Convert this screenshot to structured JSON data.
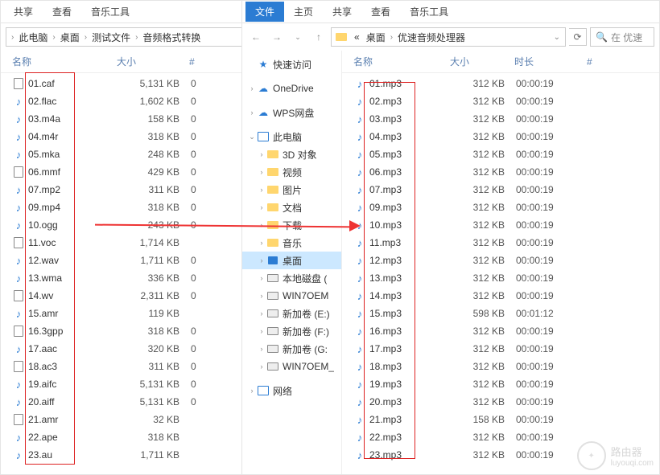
{
  "left_window": {
    "tabs": [
      "共享",
      "查看",
      "音乐工具"
    ],
    "breadcrumbs": [
      "此电脑",
      "桌面",
      "测试文件",
      "音频格式转换"
    ],
    "columns": {
      "name": "名称",
      "size": "大小",
      "hash": "#"
    },
    "files": [
      {
        "name": "01.caf",
        "size": "5,131 KB",
        "hash": "0",
        "icon": "doc"
      },
      {
        "name": "02.flac",
        "size": "1,602 KB",
        "hash": "0",
        "icon": "music"
      },
      {
        "name": "03.m4a",
        "size": "158 KB",
        "hash": "0",
        "icon": "music"
      },
      {
        "name": "04.m4r",
        "size": "318 KB",
        "hash": "0",
        "icon": "music"
      },
      {
        "name": "05.mka",
        "size": "248 KB",
        "hash": "0",
        "icon": "music"
      },
      {
        "name": "06.mmf",
        "size": "429 KB",
        "hash": "0",
        "icon": "doc"
      },
      {
        "name": "07.mp2",
        "size": "311 KB",
        "hash": "0",
        "icon": "music"
      },
      {
        "name": "09.mp4",
        "size": "318 KB",
        "hash": "0",
        "icon": "music"
      },
      {
        "name": "10.ogg",
        "size": "243 KB",
        "hash": "0",
        "icon": "music"
      },
      {
        "name": "11.voc",
        "size": "1,714 KB",
        "hash": "",
        "icon": "doc"
      },
      {
        "name": "12.wav",
        "size": "1,711 KB",
        "hash": "0",
        "icon": "music"
      },
      {
        "name": "13.wma",
        "size": "336 KB",
        "hash": "0",
        "icon": "music"
      },
      {
        "name": "14.wv",
        "size": "2,311 KB",
        "hash": "0",
        "icon": "doc"
      },
      {
        "name": "15.amr",
        "size": "119 KB",
        "hash": "",
        "icon": "music"
      },
      {
        "name": "16.3gpp",
        "size": "318 KB",
        "hash": "0",
        "icon": "doc"
      },
      {
        "name": "17.aac",
        "size": "320 KB",
        "hash": "0",
        "icon": "music"
      },
      {
        "name": "18.ac3",
        "size": "311 KB",
        "hash": "0",
        "icon": "doc"
      },
      {
        "name": "19.aifc",
        "size": "5,131 KB",
        "hash": "0",
        "icon": "music"
      },
      {
        "name": "20.aiff",
        "size": "5,131 KB",
        "hash": "0",
        "icon": "music"
      },
      {
        "name": "21.amr",
        "size": "32 KB",
        "hash": "",
        "icon": "doc"
      },
      {
        "name": "22.ape",
        "size": "318 KB",
        "hash": "",
        "icon": "music"
      },
      {
        "name": "23.au",
        "size": "1,711 KB",
        "hash": "",
        "icon": "music"
      }
    ]
  },
  "right_window": {
    "tabs": [
      "文件",
      "主页",
      "共享",
      "查看",
      "音乐工具"
    ],
    "breadcrumbs_prefix": "«",
    "breadcrumbs": [
      "桌面",
      "优速音频处理器"
    ],
    "search_placeholder": "在 优速",
    "columns": {
      "name": "名称",
      "size": "大小",
      "duration": "时长",
      "hash": "#"
    },
    "sidebar": [
      {
        "label": "快速访问",
        "icon": "star",
        "expand": "none",
        "indent": 0
      },
      {
        "label": "OneDrive",
        "icon": "cloud",
        "expand": "collapsed",
        "indent": 0
      },
      {
        "label": "WPS网盘",
        "icon": "cloud",
        "expand": "collapsed",
        "indent": 0
      },
      {
        "label": "此电脑",
        "icon": "pc",
        "expand": "expanded",
        "indent": 0
      },
      {
        "label": "3D 对象",
        "icon": "folder",
        "expand": "collapsed",
        "indent": 1
      },
      {
        "label": "视频",
        "icon": "folder",
        "expand": "collapsed",
        "indent": 1
      },
      {
        "label": "图片",
        "icon": "folder",
        "expand": "collapsed",
        "indent": 1
      },
      {
        "label": "文档",
        "icon": "folder",
        "expand": "collapsed",
        "indent": 1
      },
      {
        "label": "下载",
        "icon": "folder",
        "expand": "collapsed",
        "indent": 1
      },
      {
        "label": "音乐",
        "icon": "folder",
        "expand": "collapsed",
        "indent": 1
      },
      {
        "label": "桌面",
        "icon": "desktop",
        "expand": "collapsed",
        "indent": 1,
        "selected": true
      },
      {
        "label": "本地磁盘 (",
        "icon": "drive",
        "expand": "collapsed",
        "indent": 1
      },
      {
        "label": "WIN7OEM",
        "icon": "drive",
        "expand": "collapsed",
        "indent": 1
      },
      {
        "label": "新加卷 (E:)",
        "icon": "drive",
        "expand": "collapsed",
        "indent": 1
      },
      {
        "label": "新加卷 (F:)",
        "icon": "drive",
        "expand": "collapsed",
        "indent": 1
      },
      {
        "label": "新加卷 (G:",
        "icon": "drive",
        "expand": "collapsed",
        "indent": 1
      },
      {
        "label": "WIN7OEM_",
        "icon": "drive",
        "expand": "collapsed",
        "indent": 1
      },
      {
        "label": "网络",
        "icon": "pc",
        "expand": "collapsed",
        "indent": 0
      }
    ],
    "files": [
      {
        "name": "01.mp3",
        "size": "312 KB",
        "duration": "00:00:19"
      },
      {
        "name": "02.mp3",
        "size": "312 KB",
        "duration": "00:00:19"
      },
      {
        "name": "03.mp3",
        "size": "312 KB",
        "duration": "00:00:19"
      },
      {
        "name": "04.mp3",
        "size": "312 KB",
        "duration": "00:00:19"
      },
      {
        "name": "05.mp3",
        "size": "312 KB",
        "duration": "00:00:19"
      },
      {
        "name": "06.mp3",
        "size": "312 KB",
        "duration": "00:00:19"
      },
      {
        "name": "07.mp3",
        "size": "312 KB",
        "duration": "00:00:19"
      },
      {
        "name": "09.mp3",
        "size": "312 KB",
        "duration": "00:00:19"
      },
      {
        "name": "10.mp3",
        "size": "312 KB",
        "duration": "00:00:19"
      },
      {
        "name": "11.mp3",
        "size": "312 KB",
        "duration": "00:00:19"
      },
      {
        "name": "12.mp3",
        "size": "312 KB",
        "duration": "00:00:19"
      },
      {
        "name": "13.mp3",
        "size": "312 KB",
        "duration": "00:00:19"
      },
      {
        "name": "14.mp3",
        "size": "312 KB",
        "duration": "00:00:19"
      },
      {
        "name": "15.mp3",
        "size": "598 KB",
        "duration": "00:01:12"
      },
      {
        "name": "16.mp3",
        "size": "312 KB",
        "duration": "00:00:19"
      },
      {
        "name": "17.mp3",
        "size": "312 KB",
        "duration": "00:00:19"
      },
      {
        "name": "18.mp3",
        "size": "312 KB",
        "duration": "00:00:19"
      },
      {
        "name": "19.mp3",
        "size": "312 KB",
        "duration": "00:00:19"
      },
      {
        "name": "20.mp3",
        "size": "312 KB",
        "duration": "00:00:19"
      },
      {
        "name": "21.mp3",
        "size": "158 KB",
        "duration": "00:00:19"
      },
      {
        "name": "22.mp3",
        "size": "312 KB",
        "duration": "00:00:19"
      },
      {
        "name": "23.mp3",
        "size": "312 KB",
        "duration": "00:00:19"
      }
    ]
  },
  "watermark": {
    "text": "路由器",
    "sub": "luyouqi.com"
  },
  "icons": {
    "search": "🔍"
  }
}
